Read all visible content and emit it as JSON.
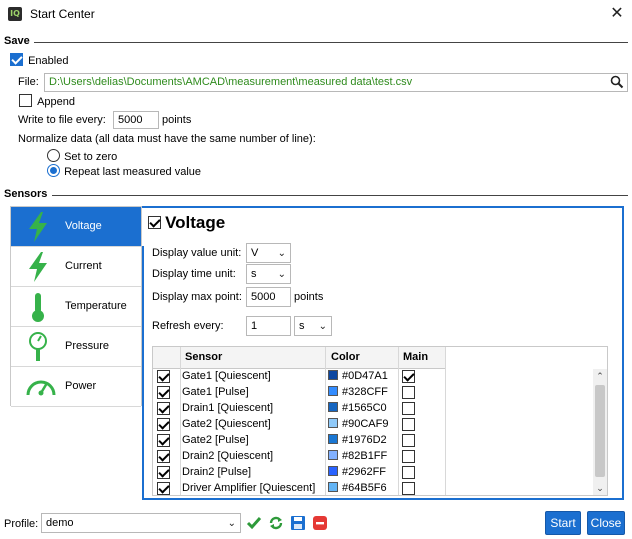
{
  "window": {
    "title": "Start Center",
    "app_icon_text": "IQ"
  },
  "save": {
    "section_title": "Save",
    "enabled_label": "Enabled",
    "enabled_checked": true,
    "file_label": "File:",
    "file_value": "D:\\Users\\delias\\Documents\\AMCAD\\measurement\\measured data\\test.csv",
    "append_label": "Append",
    "append_checked": false,
    "write_every_label": "Write to file every:",
    "write_every_value": "5000",
    "write_every_unit": "points",
    "normalize_label": "Normalize data (all data must have the same number of line):",
    "normalize_options": [
      {
        "label": "Set to zero",
        "selected": false
      },
      {
        "label": "Repeat last measured value",
        "selected": true
      }
    ]
  },
  "sensors": {
    "section_title": "Sensors",
    "sidebar": [
      {
        "label": "Voltage",
        "icon": "lightning-icon",
        "active": true
      },
      {
        "label": "Current",
        "icon": "lightning-icon",
        "active": false
      },
      {
        "label": "Temperature",
        "icon": "thermometer-icon",
        "active": false
      },
      {
        "label": "Pressure",
        "icon": "pressure-gauge-icon",
        "active": false
      },
      {
        "label": "Power",
        "icon": "speedometer-icon",
        "active": false
      }
    ],
    "panel": {
      "title": "Voltage",
      "title_checked": true,
      "display_value_unit_label": "Display value unit:",
      "display_value_unit": "V",
      "display_time_unit_label": "Display time unit:",
      "display_time_unit": "s",
      "display_max_point_label": "Display max point:",
      "display_max_point": "5000",
      "display_max_point_unit": "points",
      "refresh_label": "Refresh every:",
      "refresh_value": "1",
      "refresh_unit": "s",
      "table": {
        "headers": {
          "sensor": "Sensor",
          "color": "Color",
          "main": "Main"
        },
        "rows": [
          {
            "enabled": true,
            "sensor": "Gate1 [Quiescent]",
            "color": "#0D47A1",
            "main": true
          },
          {
            "enabled": true,
            "sensor": "Gate1 [Pulse]",
            "color": "#328CFF",
            "main": false
          },
          {
            "enabled": true,
            "sensor": "Drain1 [Quiescent]",
            "color": "#1565C0",
            "main": false
          },
          {
            "enabled": true,
            "sensor": "Gate2 [Quiescent]",
            "color": "#90CAF9",
            "main": false
          },
          {
            "enabled": true,
            "sensor": "Gate2 [Pulse]",
            "color": "#1976D2",
            "main": false
          },
          {
            "enabled": true,
            "sensor": "Drain2 [Quiescent]",
            "color": "#82B1FF",
            "main": false
          },
          {
            "enabled": true,
            "sensor": "Drain2 [Pulse]",
            "color": "#2962FF",
            "main": false
          },
          {
            "enabled": true,
            "sensor": "Driver Amplifier [Quiescent]",
            "color": "#64B5F6",
            "main": false
          }
        ]
      }
    }
  },
  "footer": {
    "profile_label": "Profile:",
    "profile_value": "demo",
    "start_label": "Start",
    "close_label": "Close"
  },
  "colors": {
    "accent": "#1b6fd0",
    "file_text": "#2f8b1d"
  }
}
